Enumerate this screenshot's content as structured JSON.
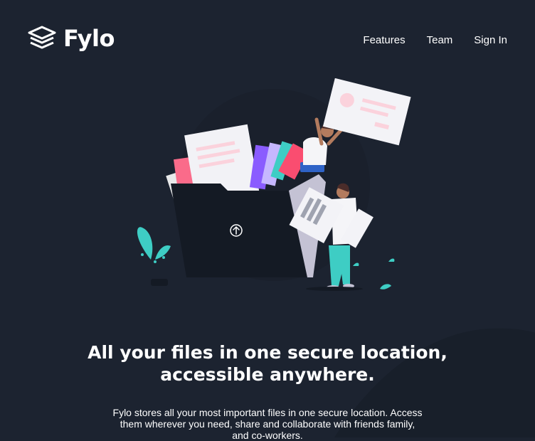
{
  "brand": {
    "name": "Fylo",
    "logo_icon": "stacked-layers-icon"
  },
  "nav": {
    "items": [
      "Features",
      "Team",
      "Sign In"
    ]
  },
  "hero": {
    "illustration_icon": "upload-arrow-icon",
    "title_line1": "All your files in one secure location,",
    "title_line2": "accessible anywhere.",
    "description": "Fylo stores all your most important files in one secure location. Access them wherever you need, share and collaborate with friends family, and co-workers."
  },
  "colors": {
    "background": "#1c2330",
    "curve": "#181f2a",
    "folder": "#141a24",
    "accent_teal": "#3ecdc4",
    "accent_pink": "#fa4d70",
    "text": "#ffffff"
  }
}
